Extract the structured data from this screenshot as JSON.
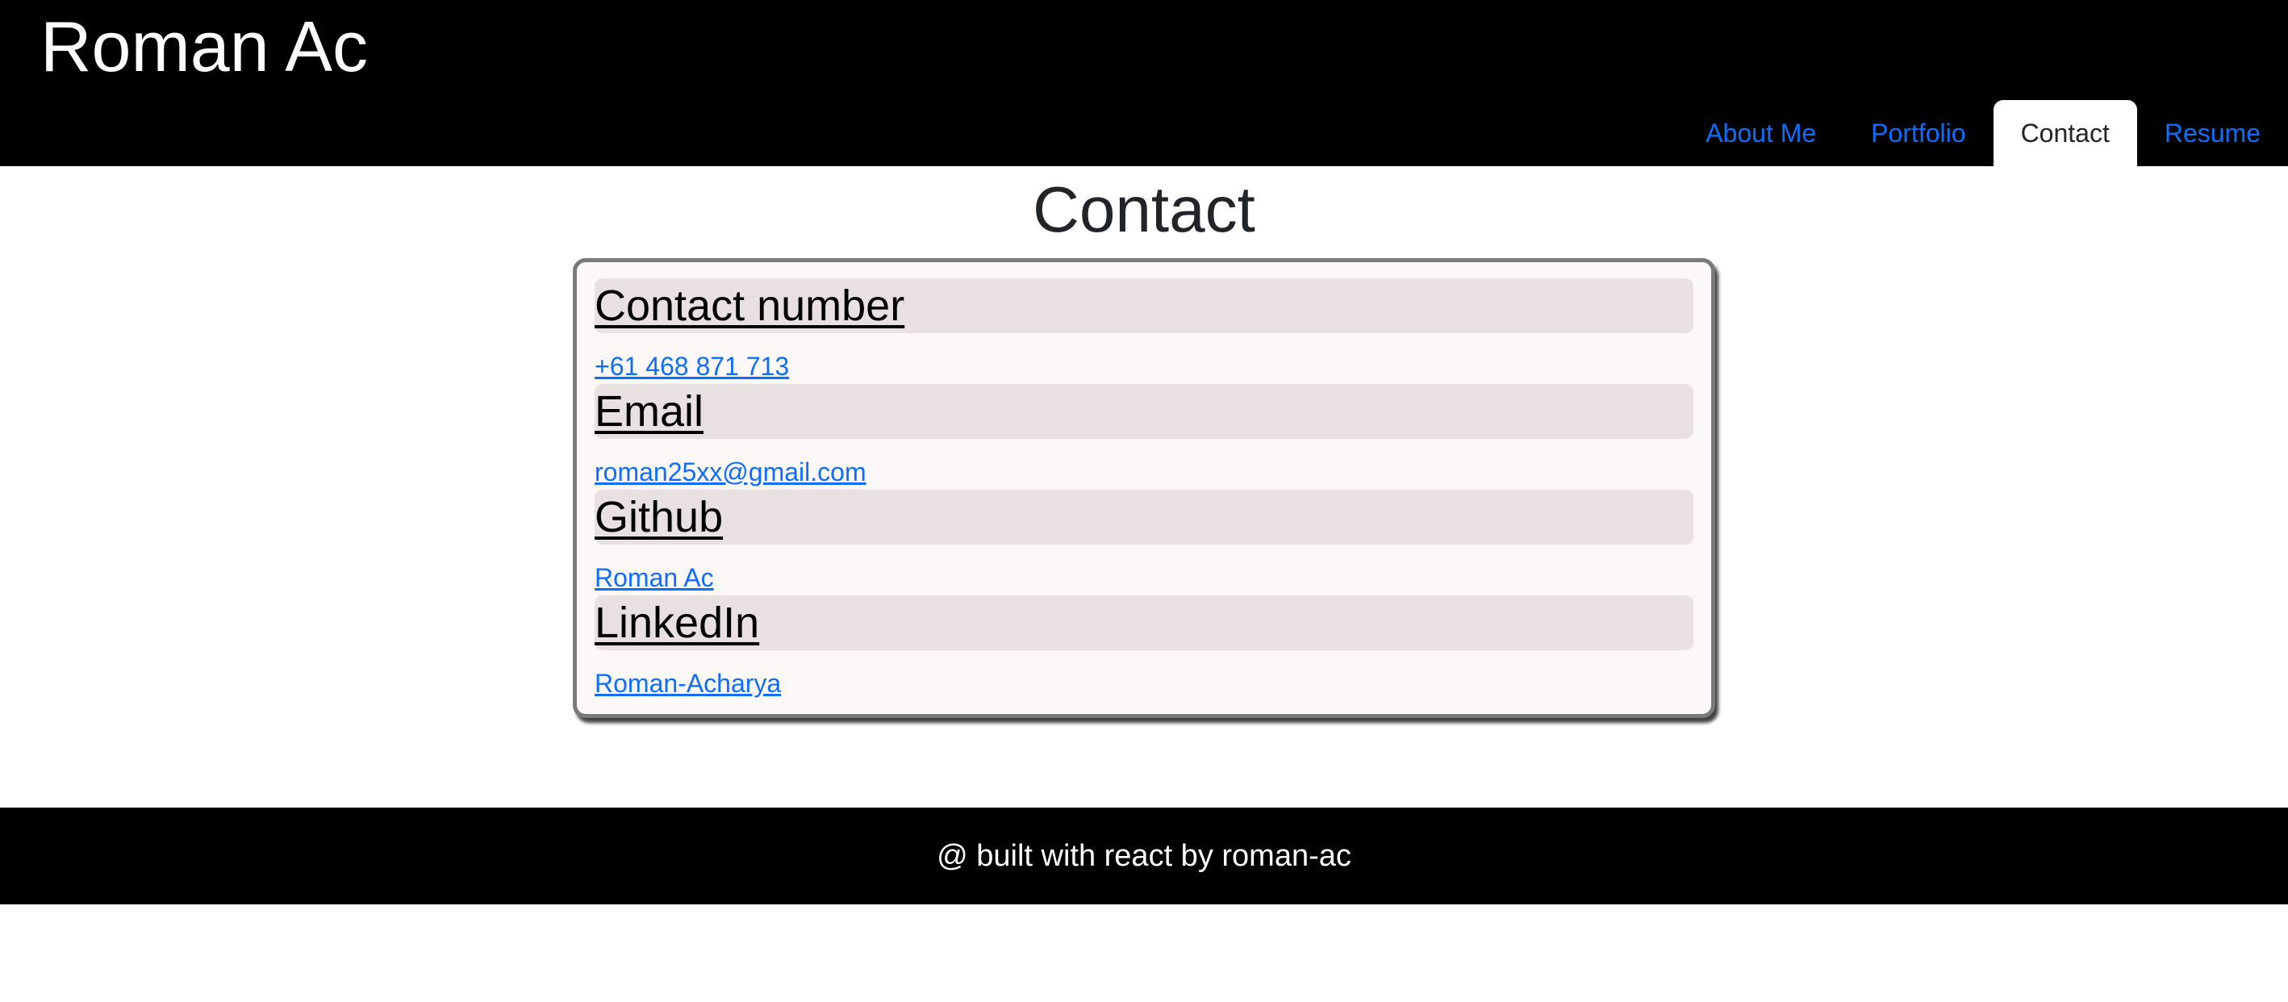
{
  "header": {
    "title": "Roman Ac",
    "nav": [
      {
        "label": "About Me",
        "active": false
      },
      {
        "label": "Portfolio",
        "active": false
      },
      {
        "label": "Contact",
        "active": true
      },
      {
        "label": "Resume",
        "active": false
      }
    ]
  },
  "main": {
    "title": "Contact",
    "sections": [
      {
        "heading": "Contact number",
        "link": "+61 468 871 713"
      },
      {
        "heading": "Email",
        "link": "roman25xx@gmail.com"
      },
      {
        "heading": "Github",
        "link": "Roman Ac"
      },
      {
        "heading": "LinkedIn",
        "link": "Roman-Acharya"
      }
    ]
  },
  "footer": {
    "text": "@ built with react by roman-ac"
  },
  "colors": {
    "header_bg": "#000000",
    "link": "#0d6efd",
    "active_tab_text": "#212529",
    "card_bg": "#fdf8f8",
    "section_head_bg": "#e8e0e1"
  }
}
